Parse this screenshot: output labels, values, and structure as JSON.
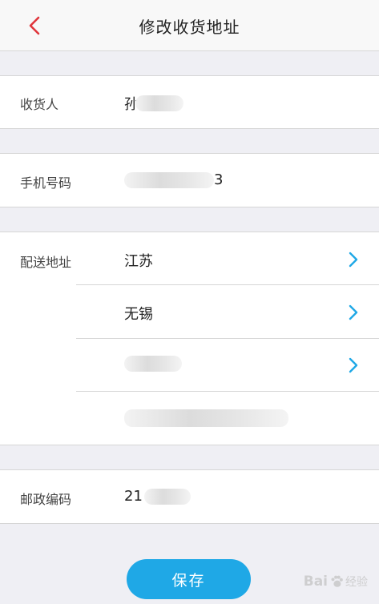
{
  "header": {
    "title": "修改收货地址",
    "back_icon": "chevron-left-icon"
  },
  "fields": {
    "recipient": {
      "label": "收货人",
      "value": "孙"
    },
    "phone": {
      "label": "手机号码",
      "value": "3"
    },
    "address": {
      "label": "配送地址",
      "province": "江苏",
      "city": "无锡"
    },
    "postcode": {
      "label": "邮政编码",
      "value": "21"
    }
  },
  "actions": {
    "save_label": "保存"
  },
  "watermark": {
    "brand": "Bai",
    "suffix": "经验"
  },
  "colors": {
    "accent": "#1fa8e6",
    "back_red": "#e0353b",
    "chevron_blue": "#1fa8e6",
    "background": "#efeff4"
  }
}
